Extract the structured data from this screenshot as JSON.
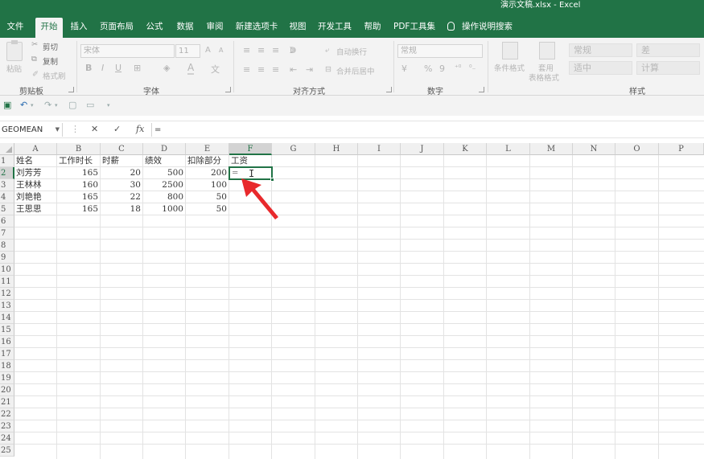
{
  "title_bar": {
    "title": "演示文稿.xlsx - Excel"
  },
  "menu": {
    "tabs": [
      "文件",
      "开始",
      "插入",
      "页面布局",
      "公式",
      "数据",
      "审阅",
      "新建选项卡",
      "视图",
      "开发工具",
      "帮助",
      "PDF工具集"
    ],
    "active_tab": "开始",
    "tell_me": "操作说明搜索"
  },
  "ribbon": {
    "clipboard": {
      "paste": "粘贴",
      "cut": "剪切",
      "copy": "复制",
      "format_painter": "格式刷",
      "label": "剪贴板"
    },
    "font": {
      "name": "宋体",
      "size": "11",
      "label": "字体",
      "bold": "B",
      "italic": "I",
      "underline": "U",
      "grow": "A",
      "shrink": "A",
      "font_color": "A"
    },
    "alignment": {
      "wrap": "自动换行",
      "merge": "合并后居中",
      "label": "对齐方式"
    },
    "number": {
      "format": "常规",
      "percent": "%",
      "comma": "9",
      "label": "数字"
    },
    "styles": {
      "conditional": "条件格式",
      "table_line1": "套用",
      "table_line2": "表格格式",
      "cells": [
        "常规",
        "差",
        "适中",
        "计算"
      ],
      "label": "样式"
    }
  },
  "formula_bar": {
    "name_box": "GEOMEAN",
    "cancel": "✕",
    "enter": "✓",
    "fx": "fx",
    "content": "="
  },
  "sheet": {
    "columns": [
      "A",
      "B",
      "C",
      "D",
      "E",
      "F",
      "G",
      "H",
      "I",
      "J",
      "K",
      "L",
      "M",
      "N",
      "O",
      "P"
    ],
    "rows": [
      "1",
      "2",
      "3",
      "4",
      "5",
      "6",
      "7",
      "8",
      "9",
      "10",
      "11",
      "12",
      "13",
      "14",
      "15",
      "16",
      "17",
      "18",
      "19",
      "20",
      "21",
      "22",
      "23",
      "24",
      "25"
    ],
    "active_column": "F",
    "active_row": "2",
    "headers": [
      "姓名",
      "工作时长",
      "时薪",
      "绩效",
      "扣除部分",
      "工资"
    ],
    "data": [
      [
        "刘芳芳",
        "165",
        "20",
        "500",
        "200"
      ],
      [
        "王林林",
        "160",
        "30",
        "2500",
        "100"
      ],
      [
        "刘艳艳",
        "165",
        "22",
        "800",
        "50"
      ],
      [
        "王思思",
        "165",
        "18",
        "1000",
        "50"
      ]
    ],
    "active_cell_value": "="
  },
  "colors": {
    "excel_green": "#217346",
    "annotation_red": "#e8292c"
  }
}
